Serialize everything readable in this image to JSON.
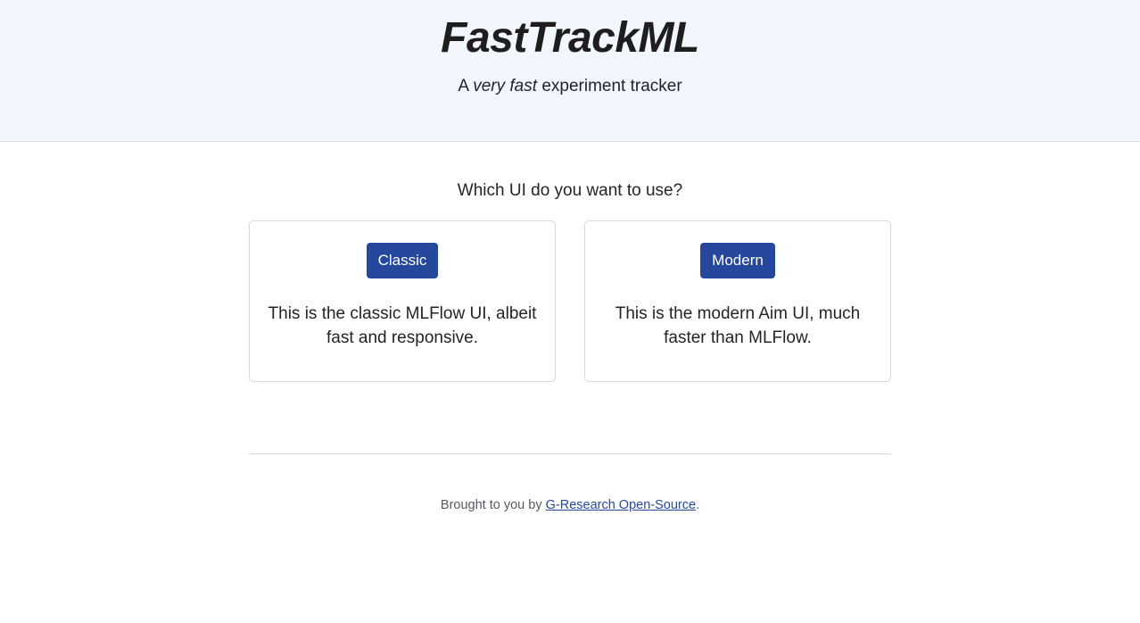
{
  "hero": {
    "title": "FastTrackML",
    "subtitle_prefix": "A ",
    "subtitle_emphasis": "very fast",
    "subtitle_suffix": " experiment tracker"
  },
  "main": {
    "question": "Which UI do you want to use?",
    "options": [
      {
        "button_label": "Classic",
        "description": "This is the classic MLFlow UI, albeit fast and responsive."
      },
      {
        "button_label": "Modern",
        "description": "This is the modern Aim UI, much faster than MLFlow."
      }
    ]
  },
  "footer": {
    "prefix": "Brought to you by ",
    "link_text": "G-Research Open-Source",
    "suffix": "."
  },
  "colors": {
    "hero_background": "#f2f6fd",
    "button_background": "#25479c",
    "button_text": "#ffffff",
    "link": "#25479c"
  }
}
